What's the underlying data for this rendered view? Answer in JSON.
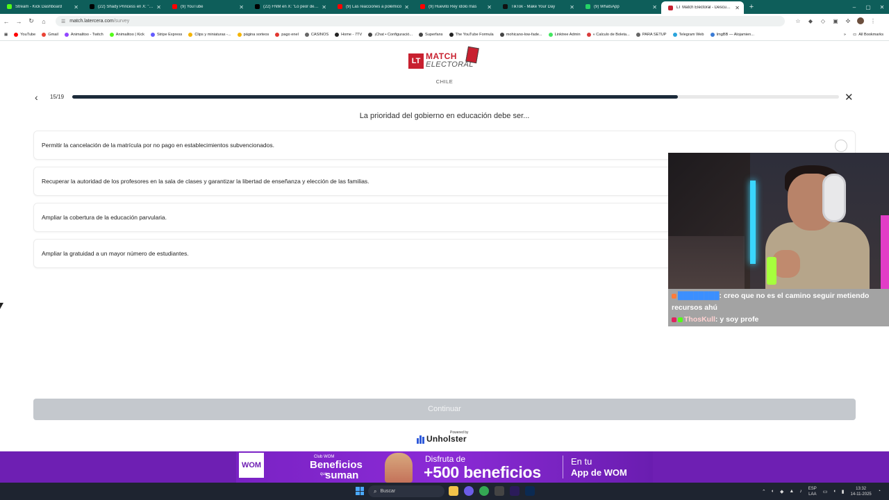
{
  "browser": {
    "tabs": [
      {
        "title": "Stream - Kick Dashboard",
        "color": "#53fc18"
      },
      {
        "title": "(22) Shady Princess en X: \"9 mil",
        "color": "#000000"
      },
      {
        "title": "(9) YouTube",
        "color": "#ff0000"
      },
      {
        "title": "(22) FNM en X: \"Lo peor del vid",
        "color": "#000000"
      },
      {
        "title": "(9) Las reacciones a polémico",
        "color": "#ff0000"
      },
      {
        "title": "(9) Huevito Rey ídolo más",
        "color": "#ff0000"
      },
      {
        "title": "TikTok - Make Your Day",
        "color": "#111111"
      },
      {
        "title": "(9) WhatsApp",
        "color": "#25d366"
      },
      {
        "title": "LT Match Electoral - Descubre",
        "color": "#c8202f",
        "active": true
      }
    ],
    "new_tab": "+",
    "url_host": "match.latercera.com",
    "url_path": "/survey",
    "bookmarks": [
      {
        "label": "YouTube",
        "color": "#ff0000"
      },
      {
        "label": "Gmail",
        "color": "#ea4335"
      },
      {
        "label": "Animalitoo - Twitch",
        "color": "#9146ff"
      },
      {
        "label": "Animalitoo | Kick",
        "color": "#53fc18"
      },
      {
        "label": "Stripe Express",
        "color": "#635bff"
      },
      {
        "label": "Clips y miniaturas -...",
        "color": "#f4b400"
      },
      {
        "label": "página sorteos",
        "color": "#f4b400"
      },
      {
        "label": "pago enel",
        "color": "#e2362f"
      },
      {
        "label": "CASINOS",
        "color": "#666666"
      },
      {
        "label": "Home - 7TV",
        "color": "#222222"
      },
      {
        "label": "¡Chat • Configuració...",
        "color": "#444444"
      },
      {
        "label": "Superfans",
        "color": "#444444"
      },
      {
        "label": "The YouTube Formula",
        "color": "#222222"
      },
      {
        "label": "mohicano-low-fade...",
        "color": "#444444"
      },
      {
        "label": "Linktree Admin",
        "color": "#43e660"
      },
      {
        "label": "« Calculo de Boleta...",
        "color": "#d93b3b"
      },
      {
        "label": "PARA SETUP",
        "color": "#666666"
      },
      {
        "label": "Telegram Web",
        "color": "#2aa4dc"
      },
      {
        "label": "ImgBB — Alojamien...",
        "color": "#3a7bd5"
      }
    ],
    "all_bookmarks": "All Bookmarks"
  },
  "page": {
    "logo": {
      "lt": "LT",
      "match": "MATCH",
      "electoral": "ELECTORAL"
    },
    "country": "CHILE",
    "progress": {
      "text": "15/19",
      "current": 15,
      "total": 19,
      "color": "#1c2b3a"
    },
    "question": "La prioridad del gobierno en educación debe ser...",
    "options": [
      "Permitir la cancelación de la matrícula por no pago en establecimientos subvencionados.",
      "Recuperar la autoridad de los profesores en la sala de clases y garantizar la libertad de enseñanza y elección de las familias.",
      "Ampliar la cobertura de la educación parvularia.",
      "Ampliar la gratuidad a un mayor número de estudiantes."
    ],
    "continue_label": "Continuar",
    "powered_by": "Powered by",
    "powered_name": "Unholster"
  },
  "stream_overlay": {
    "chat": [
      {
        "user": "████████",
        "message": "creo que no es el camino seguir metiendo recursos ahú"
      },
      {
        "user": "ThosKull",
        "message": "y soy profe"
      }
    ]
  },
  "ad": {
    "brand": "WOM",
    "club": "Club WOM",
    "beneficios": "Beneficios",
    "que": "que",
    "suman": "suman",
    "disfruta": "Disfruta de",
    "big": "+500 beneficios",
    "en_tu": "En tu",
    "app": "App de WOM",
    "accent": "#6e1fb3"
  },
  "taskbar": {
    "search_placeholder": "Buscar",
    "lang": "ESP",
    "lang2": "LAA",
    "time": "13:32",
    "date": "14-11-2025"
  }
}
